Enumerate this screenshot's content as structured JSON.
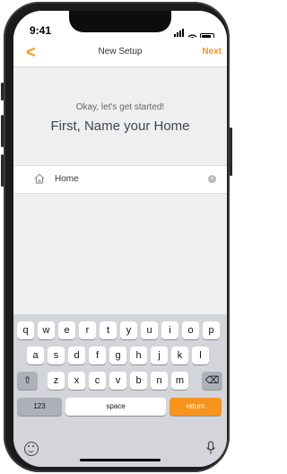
{
  "status_bar": {
    "time": "9:41"
  },
  "nav": {
    "back": "<",
    "title": "New Setup",
    "next": "Next"
  },
  "content": {
    "subtitle": "Okay, let's get started!",
    "heading": "First, Name your Home"
  },
  "field": {
    "value": "Home",
    "clear": "×"
  },
  "keyboard": {
    "row1": [
      "q",
      "w",
      "e",
      "r",
      "t",
      "y",
      "u",
      "i",
      "o",
      "p"
    ],
    "row2": [
      "a",
      "s",
      "d",
      "f",
      "g",
      "h",
      "j",
      "k",
      "l"
    ],
    "row3": [
      "z",
      "x",
      "c",
      "v",
      "b",
      "n",
      "m"
    ],
    "shift": "⇧",
    "delete": "⌫",
    "numbers": "123",
    "space": "space",
    "return": "return"
  },
  "colors": {
    "accent": "#f7941d",
    "keyboard_bg": "#d3d5da"
  }
}
